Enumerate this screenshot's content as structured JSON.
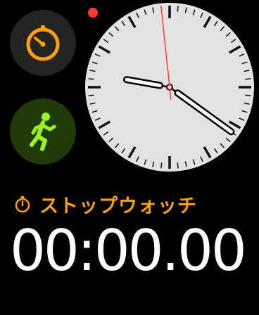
{
  "complications": {
    "timer": {
      "icon": "timer-icon",
      "color": "#ff9f0a"
    },
    "workout": {
      "icon": "running-figure-icon",
      "color": "#9cf21b"
    }
  },
  "notification": {
    "color": "#ff3b30"
  },
  "clock": {
    "face_color": "#e2e2e2",
    "second_hand_color": "#ff3b30",
    "time": {
      "hour": 9,
      "minute": 20,
      "second": 59
    }
  },
  "stopwatch": {
    "label": "ストップウォッチ",
    "label_color": "#ff9f0a",
    "time": "00:00.00"
  }
}
